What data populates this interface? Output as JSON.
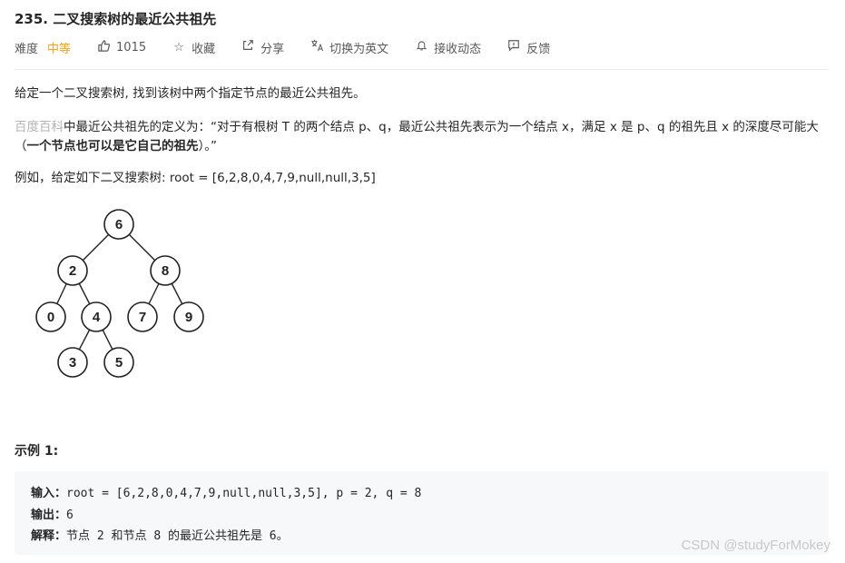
{
  "problem": {
    "title": "235. 二叉搜索树的最近公共祖先"
  },
  "meta": {
    "difficulty_label": "难度",
    "difficulty_value": "中等",
    "likes_icon": "thumbs-up-icon",
    "likes": "1015",
    "favorite_icon": "star-icon",
    "favorite": "收藏",
    "share_icon": "share-icon",
    "share": "分享",
    "translate_icon": "translate-icon",
    "translate": "切换为英文",
    "notify_icon": "bell-icon",
    "notify": "接收动态",
    "feedback_icon": "feedback-icon",
    "feedback": "反馈"
  },
  "colors": {
    "difficulty": "#ffa116",
    "baike": "#b3b3b3",
    "code_bg": "#f7f8fa"
  },
  "description": {
    "p1": "给定一个二叉搜索树, 找到该树中两个指定节点的最近公共祖先。",
    "baike": "百度百科",
    "p2_a": "中最近公共祖先的定义为：“对于有根树 T 的两个结点 p、q，最近公共祖先表示为一个结点 x，满足 x 是 p、q 的祖先且 x 的深度尽可能大（",
    "p2_bold": "一个节点也可以是它自己的祖先",
    "p2_b": "）。”",
    "p3": "例如，给定如下二叉搜索树:  root = [6,2,8,0,4,7,9,null,null,3,5]"
  },
  "tree": {
    "nodes": [
      "6",
      "2",
      "8",
      "0",
      "4",
      "7",
      "9",
      "3",
      "5"
    ]
  },
  "example": {
    "title": "示例 1:",
    "input_label": "输入：",
    "input_value": "root = [6,2,8,0,4,7,9,null,null,3,5], p = 2, q = 8",
    "output_label": "输出：",
    "output_value": "6",
    "explain_label": "解释：",
    "explain_value": "节点 2 和节点 8 的最近公共祖先是 6。"
  },
  "watermark": "CSDN @studyForMokey"
}
